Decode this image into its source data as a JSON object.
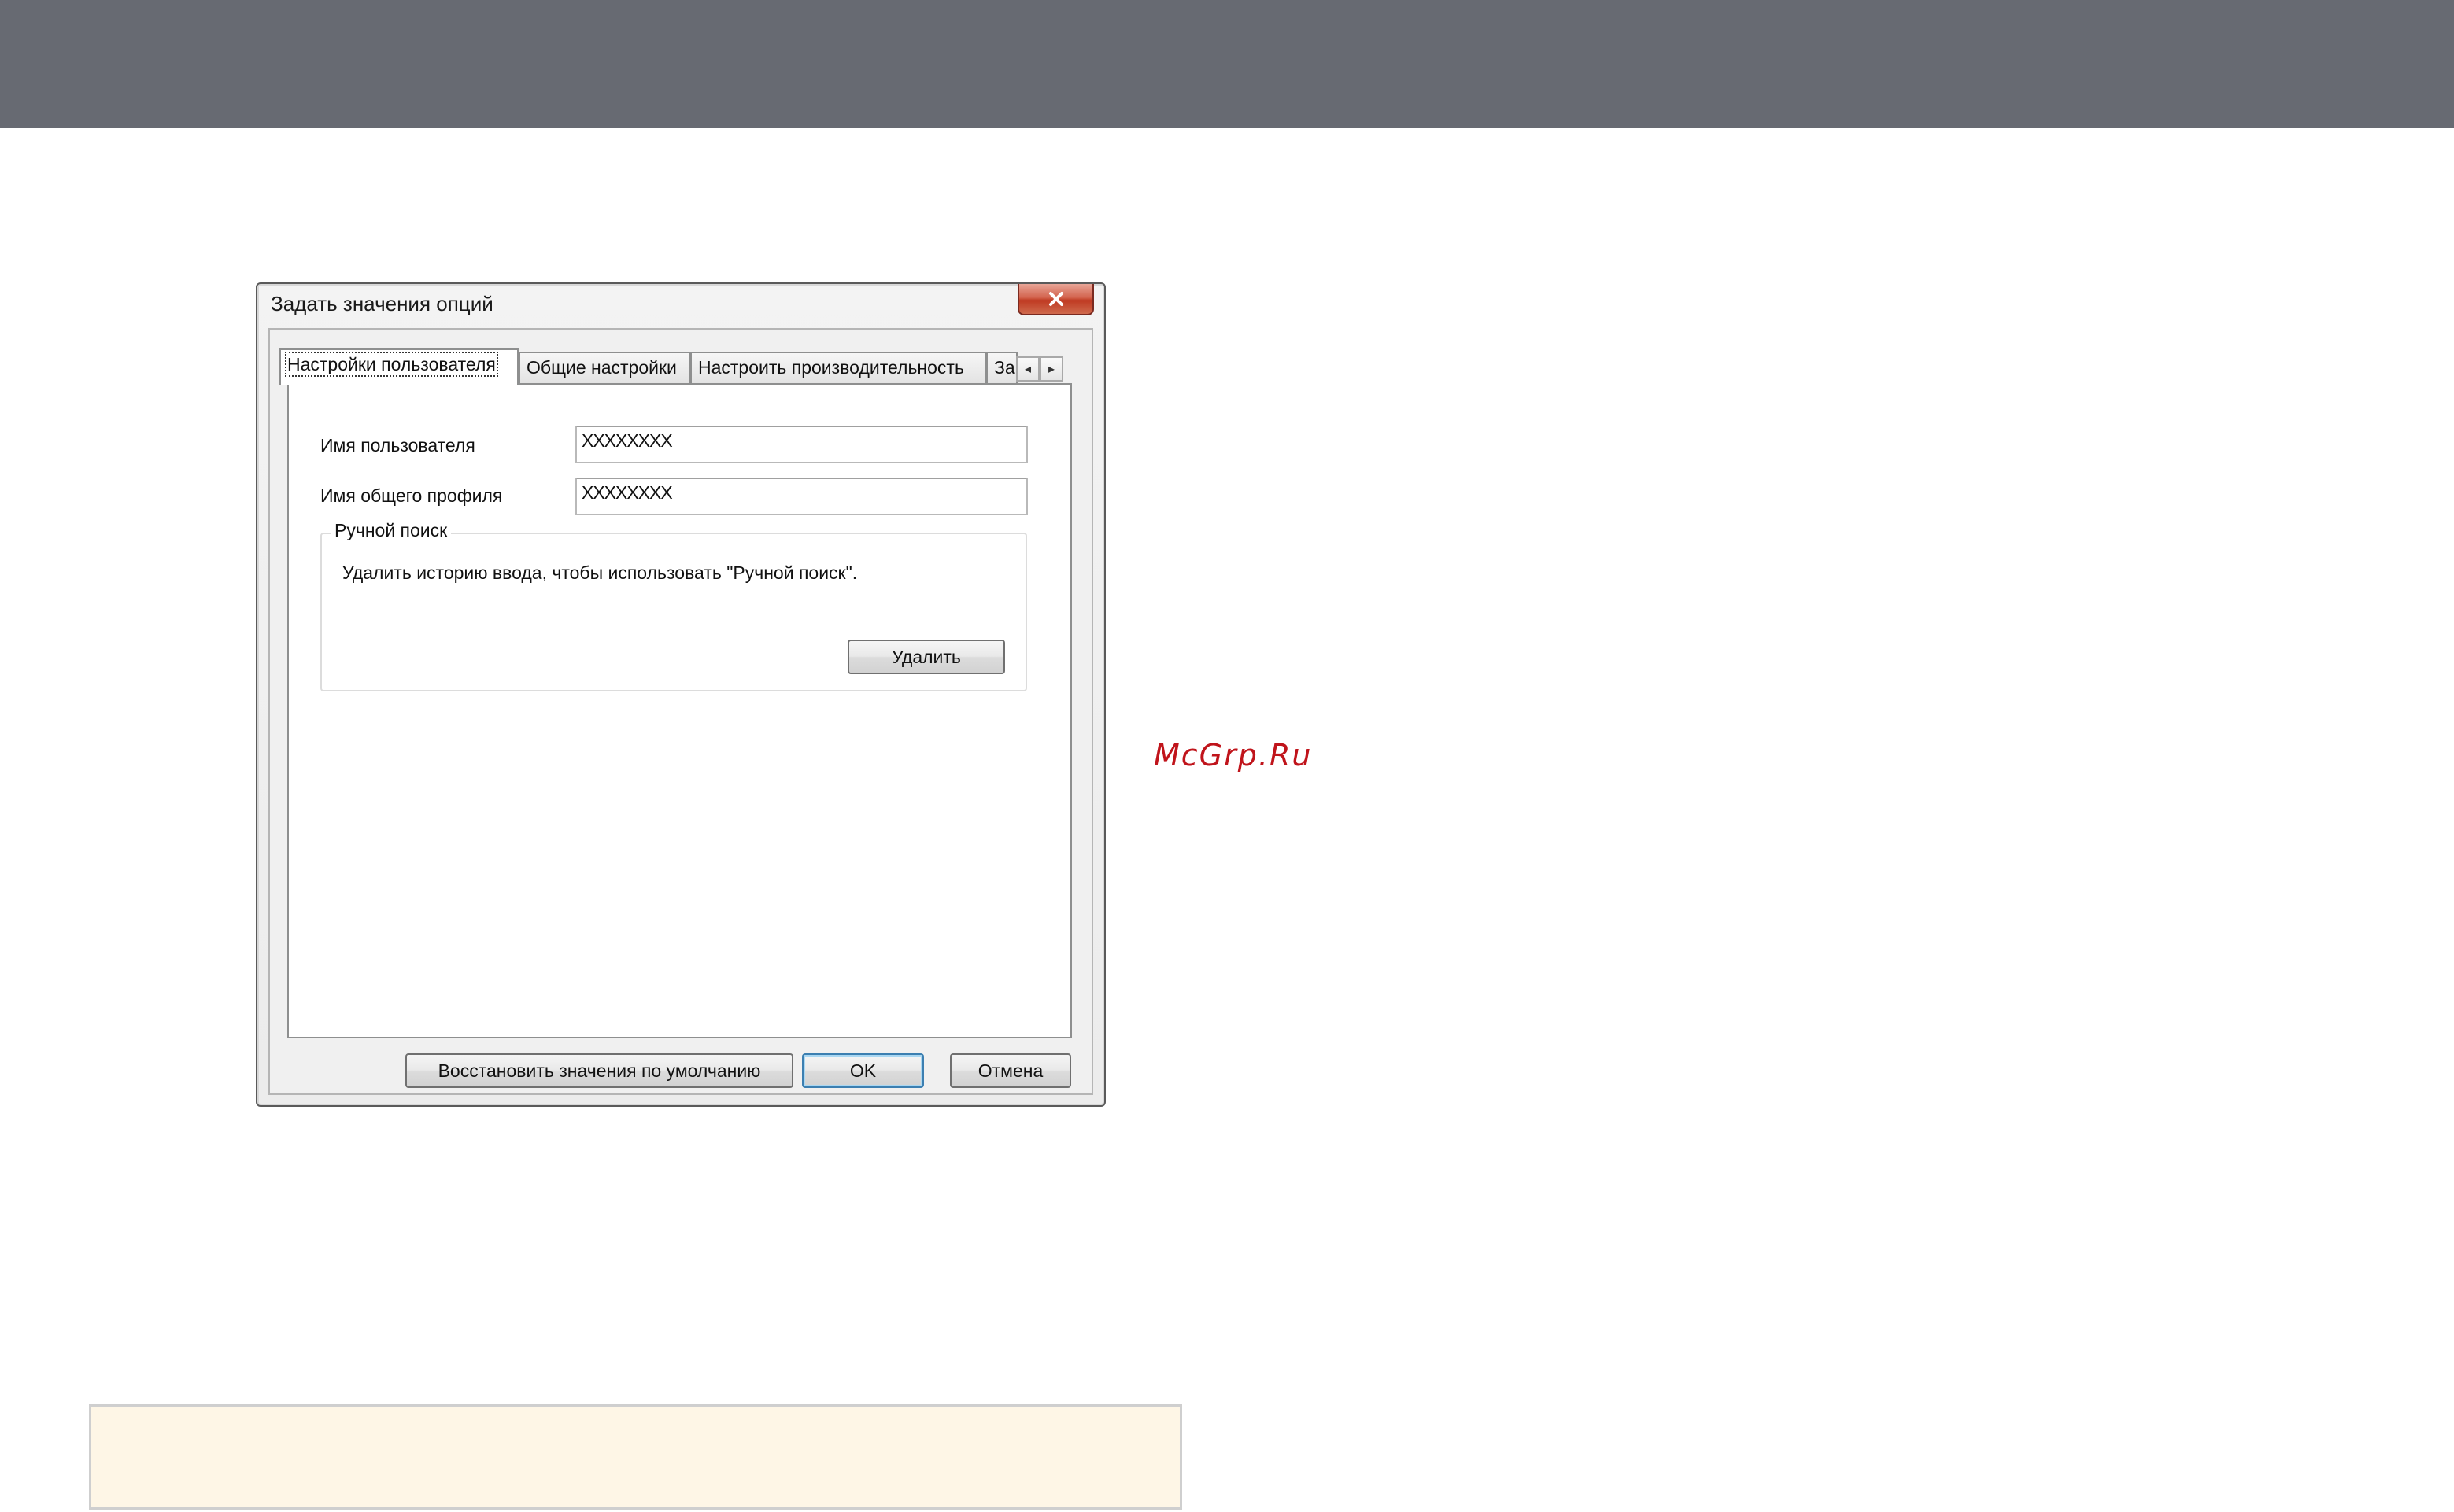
{
  "watermark": "McGrp.Ru",
  "dialog": {
    "title": "Задать значения опций",
    "close_icon": "close-x-icon",
    "tabs": [
      {
        "label": "Настройки пользователя",
        "active": true
      },
      {
        "label": "Общие настройки",
        "active": false
      },
      {
        "label": "Настроить производительность",
        "active": false
      },
      {
        "label": "За",
        "active": false
      }
    ],
    "tab_scroll": {
      "left": "◂",
      "right": "▸"
    },
    "fields": {
      "user_name_label": "Имя пользователя",
      "user_name_value": "XXXXXXXX",
      "profile_name_label": "Имя общего профиля",
      "profile_name_value": "XXXXXXXX"
    },
    "manual_search": {
      "legend": "Ручной поиск",
      "description": "Удалить историю ввода, чтобы использовать \"Ручной поиск\".",
      "delete_label": "Удалить"
    },
    "buttons": {
      "restore_defaults": "Восстановить значения по умолчанию",
      "ok": "OK",
      "cancel": "Отмена"
    }
  },
  "colors": {
    "header_bar": "#676a72",
    "watermark": "#c0141b",
    "note_box": "#fef6e6"
  }
}
